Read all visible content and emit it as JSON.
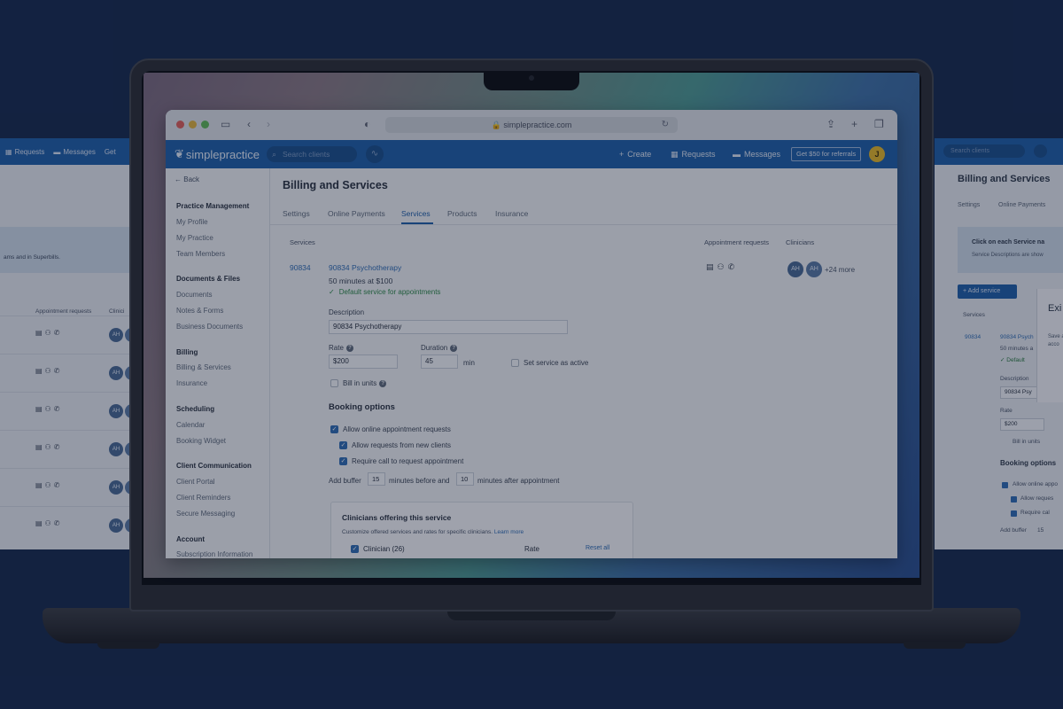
{
  "colors": {
    "page_bg": "#172a4d",
    "brand": "#1f5fa8",
    "link": "#2f6db3",
    "success": "#2f8a48",
    "user_avatar": "#e7b928"
  },
  "browser": {
    "url": "simplepractice.com"
  },
  "appbar": {
    "logo": "simplepractice",
    "search_placeholder": "Search clients",
    "create": "Create",
    "requests": "Requests",
    "messages": "Messages",
    "referral": "Get $50 for referrals",
    "user_initial": "J"
  },
  "sidebar": {
    "back": "Back",
    "sections": [
      {
        "title": "Practice Management",
        "items": [
          "My Profile",
          "My Practice",
          "Team Members"
        ]
      },
      {
        "title": "Documents & Files",
        "items": [
          "Documents",
          "Notes & Forms",
          "Business Documents"
        ]
      },
      {
        "title": "Billing",
        "items": [
          "Billing & Services",
          "Insurance"
        ]
      },
      {
        "title": "Scheduling",
        "items": [
          "Calendar",
          "Booking Widget"
        ]
      },
      {
        "title": "Client Communication",
        "items": [
          "Client Portal",
          "Client Reminders",
          "Secure Messaging"
        ]
      },
      {
        "title": "Account",
        "items": [
          "Subscription Information"
        ]
      }
    ]
  },
  "main": {
    "title": "Billing and Services",
    "tabs": [
      "Settings",
      "Online Payments",
      "Services",
      "Products",
      "Insurance"
    ],
    "active_tab": "Services",
    "columns": {
      "services": "Services",
      "appointment_requests": "Appointment requests",
      "clinicians": "Clinicians"
    },
    "service": {
      "code": "90834",
      "name": "90834 Psychotherapy",
      "summary": "50 minutes at $100",
      "default_label": "Default service for appointments",
      "description_label": "Description",
      "description_value": "90834 Psychotherapy",
      "rate_label": "Rate",
      "rate_value": "$200",
      "duration_label": "Duration",
      "duration_value": "45",
      "duration_unit": "min",
      "active_label": "Set service as active",
      "units_label": "Bill in units"
    },
    "booking": {
      "title": "Booking options",
      "allow_online": "Allow online appointment requests",
      "allow_new": "Allow requests from new clients",
      "require_call": "Require call to request appointment",
      "buffer_prefix": "Add buffer",
      "buffer_before": "15",
      "buffer_mid": "minutes before and",
      "buffer_after": "10",
      "buffer_suffix": "minutes after appointment"
    },
    "clinicians": {
      "avatars": [
        "AH",
        "AH"
      ],
      "more": "+24 more"
    },
    "offering_card": {
      "title": "Clinicians offering this service",
      "desc": "Customize offered services and rates for specific clinicians.",
      "learn_more": "Learn more",
      "clinician_col": "Clinician (26)",
      "rate_col": "Rate",
      "reset": "Reset all"
    }
  },
  "bg_left": {
    "requests": "Requests",
    "messages": "Messages",
    "get": "Get",
    "band_text": "ams and in Superbills.",
    "col_appt": "Appointment requests",
    "col_clin": "Clinici",
    "avatar": "AH"
  },
  "bg_right": {
    "search": "Search clients",
    "title": "Billing and Services",
    "tab1": "Settings",
    "tab2": "Online Payments",
    "note_title": "Click on each Service na",
    "note_sub": "Service Descriptions are show",
    "add_service": "+ Add service",
    "services": "Services",
    "code": "90834",
    "name": "90834 Psych",
    "summary": "50 minutes a",
    "default": "Default",
    "description": "Description",
    "desc_value": "90834 Psy",
    "rate": "Rate",
    "rate_value": "$200",
    "units": "Bill in units",
    "booking": "Booking options",
    "allow_online": "Allow online appo",
    "allow_new": "Allow reques",
    "require": "Require cal",
    "buffer": "Add buffer",
    "buffer_val": "15",
    "modal_title": "Exi",
    "modal_text": "Save appo acco"
  }
}
